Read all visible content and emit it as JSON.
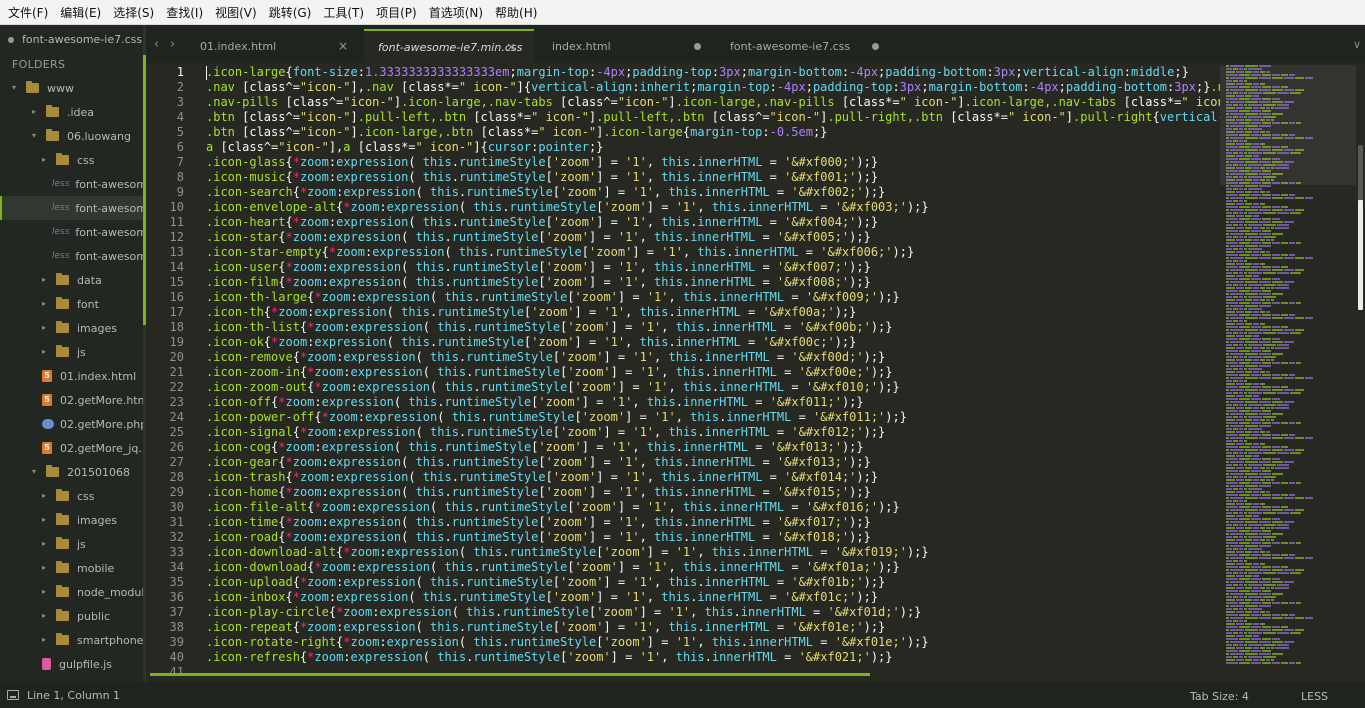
{
  "menubar": {
    "items": [
      "文件(F)",
      "编辑(E)",
      "选择(S)",
      "查找(I)",
      "视图(V)",
      "跳转(G)",
      "工具(T)",
      "项目(P)",
      "首选项(N)",
      "帮助(H)"
    ]
  },
  "sidebar": {
    "open_file": "font-awesome-ie7.css",
    "folders_label": "FOLDERS",
    "tree": [
      {
        "label": "www",
        "type": "folder",
        "depth": 0
      },
      {
        "label": ".idea",
        "type": "folder",
        "depth": 1
      },
      {
        "label": "06.luowang",
        "type": "folder",
        "depth": 1
      },
      {
        "label": "css",
        "type": "folder",
        "depth": 2
      },
      {
        "label": "font-awesom",
        "type": "less",
        "depth": 3
      },
      {
        "label": "font-awesom",
        "type": "less",
        "depth": 3,
        "selected": true
      },
      {
        "label": "font-awesom",
        "type": "less",
        "depth": 3
      },
      {
        "label": "font-awesom",
        "type": "less",
        "depth": 3
      },
      {
        "label": "data",
        "type": "folder",
        "depth": 2
      },
      {
        "label": "font",
        "type": "folder",
        "depth": 2
      },
      {
        "label": "images",
        "type": "folder",
        "depth": 2
      },
      {
        "label": "js",
        "type": "folder",
        "depth": 2
      },
      {
        "label": "01.index.html",
        "type": "html",
        "depth": 2
      },
      {
        "label": "02.getMore.htm",
        "type": "html",
        "depth": 2
      },
      {
        "label": "02.getMore.php",
        "type": "php",
        "depth": 2
      },
      {
        "label": "02.getMore_jq.",
        "type": "html",
        "depth": 2
      },
      {
        "label": "201501068",
        "type": "folder",
        "depth": 1
      },
      {
        "label": "css",
        "type": "folder",
        "depth": 2
      },
      {
        "label": "images",
        "type": "folder",
        "depth": 2
      },
      {
        "label": "js",
        "type": "folder",
        "depth": 2
      },
      {
        "label": "mobile",
        "type": "folder",
        "depth": 2
      },
      {
        "label": "node_modules",
        "type": "folder",
        "depth": 2
      },
      {
        "label": "public",
        "type": "folder",
        "depth": 2
      },
      {
        "label": "smartphone",
        "type": "folder",
        "depth": 2
      },
      {
        "label": "gulpfile.js",
        "type": "js",
        "depth": 2
      }
    ]
  },
  "tabs": [
    {
      "label": "01.index.html",
      "state": "close"
    },
    {
      "label": "font-awesome-ie7.min.css",
      "state": "close",
      "active": true
    },
    {
      "label": "index.html",
      "state": "dirty"
    },
    {
      "label": "font-awesome-ie7.css",
      "state": "dirty"
    }
  ],
  "icons": {
    "nav_back": "chevron-left-icon",
    "nav_forward": "chevron-right-icon",
    "tab_close": "close-icon",
    "tab_dirty": "unsaved-dot-icon",
    "tab_menu": "chevron-down-icon",
    "panel": "panel-toggle-icon"
  },
  "colors": {
    "accent": "#7cb518",
    "editor_bg": "#272822",
    "selector": "#a6e22e",
    "property": "#66d9ef",
    "number": "#ae81ff",
    "string": "#e6db74",
    "keyword": "#f92672"
  },
  "editor": {
    "code": [
      [
        [
          "s",
          ".icon-large"
        ],
        [
          "p",
          "{"
        ],
        [
          "k",
          "font-size"
        ],
        [
          "p",
          ":"
        ],
        [
          "n",
          "1.3333333333333333em"
        ],
        [
          "p",
          ";"
        ],
        [
          "k",
          "margin-top"
        ],
        [
          "p",
          ":"
        ],
        [
          "n",
          "-4px"
        ],
        [
          "p",
          ";"
        ],
        [
          "k",
          "padding-top"
        ],
        [
          "p",
          ":"
        ],
        [
          "n",
          "3px"
        ],
        [
          "p",
          ";"
        ],
        [
          "k",
          "margin-bottom"
        ],
        [
          "p",
          ":"
        ],
        [
          "n",
          "-4px"
        ],
        [
          "p",
          ";"
        ],
        [
          "k",
          "padding-bottom"
        ],
        [
          "p",
          ":"
        ],
        [
          "n",
          "3px"
        ],
        [
          "p",
          ";"
        ],
        [
          "k",
          "vertical-align"
        ],
        [
          "p",
          ":"
        ],
        [
          "k",
          "middle"
        ],
        [
          "p",
          ";}"
        ]
      ],
      [
        [
          "s",
          ".nav "
        ],
        [
          "p",
          "[class^="
        ],
        [
          "t",
          "\"icon-\""
        ],
        [
          "p",
          "],"
        ],
        [
          "s",
          ".nav "
        ],
        [
          "p",
          "[class*="
        ],
        [
          "t",
          "\" icon-\""
        ],
        [
          "p",
          "]{"
        ],
        [
          "k",
          "vertical-align"
        ],
        [
          "p",
          ":"
        ],
        [
          "k",
          "inherit"
        ],
        [
          "p",
          ";"
        ],
        [
          "k",
          "margin-top"
        ],
        [
          "p",
          ":"
        ],
        [
          "n",
          "-4px"
        ],
        [
          "p",
          ";"
        ],
        [
          "k",
          "padding-top"
        ],
        [
          "p",
          ":"
        ],
        [
          "n",
          "3px"
        ],
        [
          "p",
          ";"
        ],
        [
          "k",
          "margin-bottom"
        ],
        [
          "p",
          ":"
        ],
        [
          "n",
          "-4px"
        ],
        [
          "p",
          ";"
        ],
        [
          "k",
          "padding-bottom"
        ],
        [
          "p",
          ":"
        ],
        [
          "n",
          "3px"
        ],
        [
          "p",
          ";}"
        ],
        [
          "s",
          ".nav "
        ],
        [
          "p",
          "["
        ]
      ],
      [
        [
          "s",
          ".nav-pills "
        ],
        [
          "p",
          "[class^="
        ],
        [
          "t",
          "\"icon-\""
        ],
        [
          "p",
          "]"
        ],
        [
          "s",
          ".icon-large,.nav-tabs "
        ],
        [
          "p",
          "[class^="
        ],
        [
          "t",
          "\"icon-\""
        ],
        [
          "p",
          "]"
        ],
        [
          "s",
          ".icon-large,.nav-pills "
        ],
        [
          "p",
          "[class*="
        ],
        [
          "t",
          "\" icon-\""
        ],
        [
          "p",
          "]"
        ],
        [
          "s",
          ".icon-large,.nav-tabs "
        ],
        [
          "p",
          "[class*="
        ],
        [
          "t",
          "\" icon-\""
        ],
        [
          "p",
          "]."
        ]
      ],
      [
        [
          "s",
          ".btn "
        ],
        [
          "p",
          "[class^="
        ],
        [
          "t",
          "\"icon-\""
        ],
        [
          "p",
          "]"
        ],
        [
          "s",
          ".pull-left,.btn "
        ],
        [
          "p",
          "[class*="
        ],
        [
          "t",
          "\" icon-\""
        ],
        [
          "p",
          "]"
        ],
        [
          "s",
          ".pull-left,.btn "
        ],
        [
          "p",
          "[class^="
        ],
        [
          "t",
          "\"icon-\""
        ],
        [
          "p",
          "]"
        ],
        [
          "s",
          ".pull-right,.btn "
        ],
        [
          "p",
          "[class*="
        ],
        [
          "t",
          "\" icon-\""
        ],
        [
          "p",
          "]"
        ],
        [
          "s",
          ".pull-right"
        ],
        [
          "p",
          "{"
        ],
        [
          "k",
          "vertical-alig"
        ]
      ],
      [
        [
          "s",
          ".btn "
        ],
        [
          "p",
          "[class^="
        ],
        [
          "t",
          "\"icon-\""
        ],
        [
          "p",
          "]"
        ],
        [
          "s",
          ".icon-large,.btn "
        ],
        [
          "p",
          "[class*="
        ],
        [
          "t",
          "\" icon-\""
        ],
        [
          "p",
          "]"
        ],
        [
          "s",
          ".icon-large"
        ],
        [
          "p",
          "{"
        ],
        [
          "k",
          "margin-top"
        ],
        [
          "p",
          ":"
        ],
        [
          "n",
          "-0.5em"
        ],
        [
          "p",
          ";}"
        ]
      ],
      [
        [
          "s",
          "a "
        ],
        [
          "p",
          "[class^="
        ],
        [
          "t",
          "\"icon-\""
        ],
        [
          "p",
          "],"
        ],
        [
          "s",
          "a "
        ],
        [
          "p",
          "[class*="
        ],
        [
          "t",
          "\" icon-\""
        ],
        [
          "p",
          "]{"
        ],
        [
          "k",
          "cursor"
        ],
        [
          "p",
          ":"
        ],
        [
          "k",
          "pointer"
        ],
        [
          "p",
          ";}"
        ]
      ]
    ],
    "icon_rows": [
      [
        "glass",
        "xf000"
      ],
      [
        "music",
        "xf001"
      ],
      [
        "search",
        "xf002"
      ],
      [
        "envelope-alt",
        "xf003"
      ],
      [
        "heart",
        "xf004"
      ],
      [
        "star",
        "xf005"
      ],
      [
        "star-empty",
        "xf006"
      ],
      [
        "user",
        "xf007"
      ],
      [
        "film",
        "xf008"
      ],
      [
        "th-large",
        "xf009"
      ],
      [
        "th",
        "xf00a"
      ],
      [
        "th-list",
        "xf00b"
      ],
      [
        "ok",
        "xf00c"
      ],
      [
        "remove",
        "xf00d"
      ],
      [
        "zoom-in",
        "xf00e"
      ],
      [
        "zoom-out",
        "xf010"
      ],
      [
        "off",
        "xf011"
      ],
      [
        "power-off",
        "xf011"
      ],
      [
        "signal",
        "xf012"
      ],
      [
        "cog",
        "xf013"
      ],
      [
        "gear",
        "xf013"
      ],
      [
        "trash",
        "xf014"
      ],
      [
        "home",
        "xf015"
      ],
      [
        "file-alt",
        "xf016"
      ],
      [
        "time",
        "xf017"
      ],
      [
        "road",
        "xf018"
      ],
      [
        "download-alt",
        "xf019"
      ],
      [
        "download",
        "xf01a"
      ],
      [
        "upload",
        "xf01b"
      ],
      [
        "inbox",
        "xf01c"
      ],
      [
        "play-circle",
        "xf01d"
      ],
      [
        "repeat",
        "xf01e"
      ],
      [
        "rotate-right",
        "xf01e"
      ],
      [
        "refresh",
        "xf021"
      ]
    ],
    "line_count": 40,
    "current_line": 1
  },
  "status": {
    "position": "Line 1, Column 1",
    "tab_size": "Tab Size: 4",
    "syntax": "LESS"
  }
}
